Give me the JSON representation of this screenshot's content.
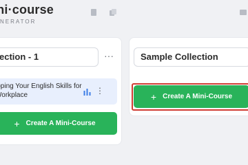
{
  "header": {
    "logo_title": "ini·course",
    "logo_subtitle": "NERATOR",
    "icons": [
      "document-icon",
      "copy-icon",
      "share-icon"
    ]
  },
  "columns": [
    {
      "title": "ection - 1",
      "more_label": "···",
      "course": {
        "title": "loping Your English Skills for Workplace",
        "stats_icon": "bar-chart-icon",
        "menu_label": "⋮"
      },
      "create_label": "Create A Mini-Course"
    },
    {
      "title": "Sample Collection",
      "create_label": "Create A Mini-Course"
    }
  ],
  "colors": {
    "green": "#29b35a",
    "card_blue": "#e8effd",
    "highlight_red": "#cf3b32",
    "icon_blue": "#3d7ee6"
  }
}
